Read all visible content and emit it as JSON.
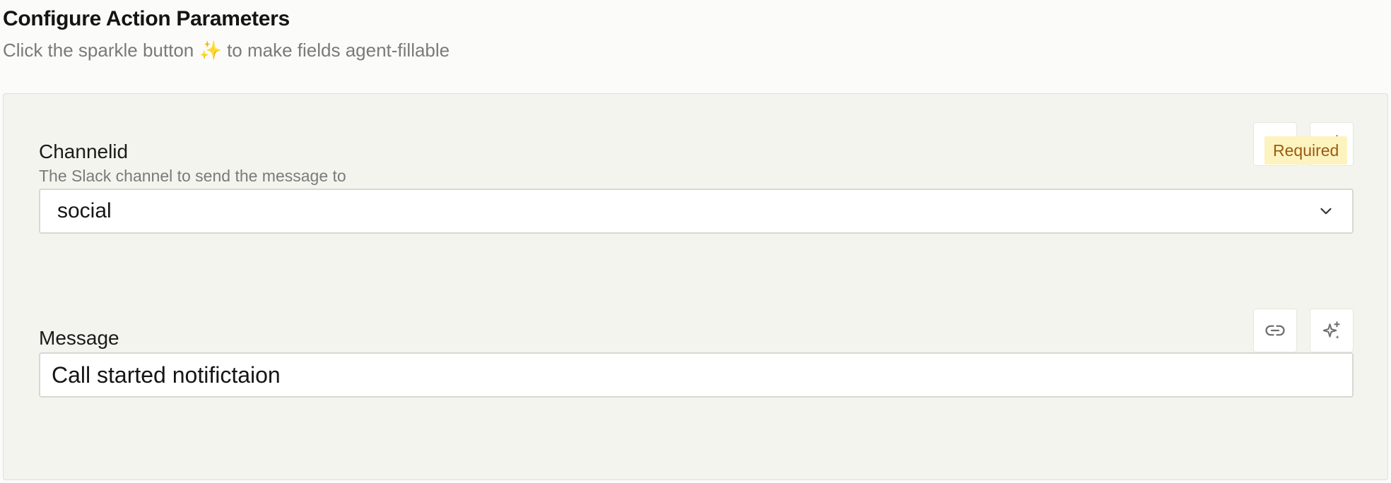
{
  "header": {
    "title": "Configure Action Parameters",
    "subtitle": "Click the sparkle button ✨ to make fields agent-fillable"
  },
  "fields": [
    {
      "label": "Channelid",
      "description": "The Slack channel to send the message to",
      "badge": "Required",
      "type": "select",
      "value": "social"
    },
    {
      "label": "Message",
      "type": "text",
      "value": "Call started notifictaion"
    }
  ],
  "icons": {
    "link": "link-icon",
    "sparkle": "sparkle-icon",
    "chevron": "chevron-down-icon"
  },
  "colors": {
    "panel_bg": "#f4f4ef",
    "badge_bg": "#fdf3bf",
    "badge_text": "#9a5b12",
    "subtitle": "#7a7a7a"
  }
}
